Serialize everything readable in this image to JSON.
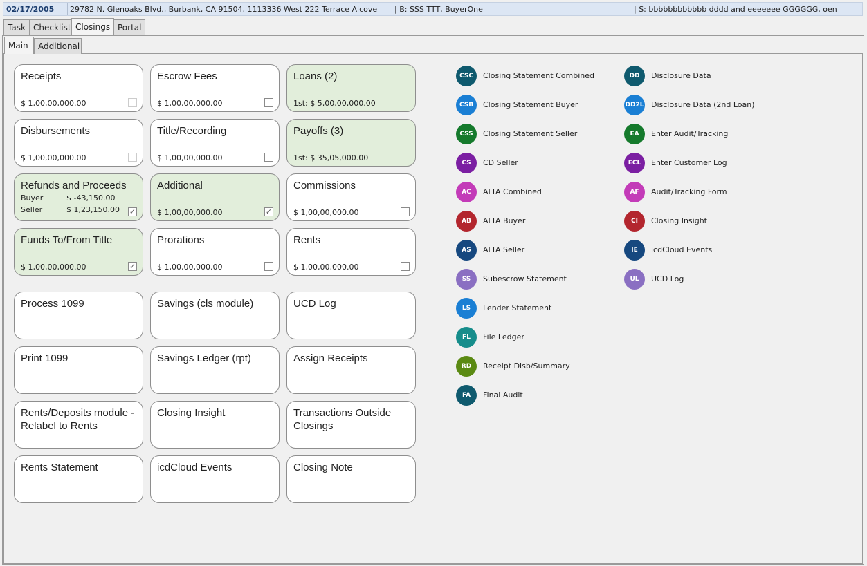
{
  "header": {
    "date": "02/17/2005",
    "address": "29782 N. Glenoaks Blvd., Burbank, CA 91504, 1113336 West 222 Terrace Alcove",
    "buyer": "| B: SSS TTT, BuyerOne",
    "seller": "| S: bbbbbbbbbbbb dddd and eeeeeee GGGGGG, oen"
  },
  "tabs": [
    "Task",
    "Checklist",
    "Closings",
    "Portal"
  ],
  "subtabs": [
    "Main",
    "Additional"
  ],
  "cards": [
    {
      "title": "Receipts",
      "value": "$ 1,00,00,000.00",
      "checkbox": "dim",
      "checked": false
    },
    {
      "title": "Escrow Fees",
      "value": "$ 1,00,00,000.00",
      "checkbox": "normal",
      "checked": false
    },
    {
      "title": "Loans (2)",
      "value": "1st:  $ 5,00,00,000.00",
      "green": true
    },
    {
      "title": "Disbursements",
      "value": "$ 1,00,00,000.00",
      "checkbox": "dim",
      "checked": false
    },
    {
      "title": "Title/Recording",
      "value": "$ 1,00,00,000.00",
      "checkbox": "normal",
      "checked": false
    },
    {
      "title": "Payoffs (3)",
      "value": "1st:  $ 35,05,000.00",
      "green": true
    },
    {
      "title": "Refunds and Proceeds",
      "green": true,
      "buyer_label": "Buyer",
      "buyer_value": "$ -43,150.00",
      "seller_label": "Seller",
      "seller_value": "$ 1,23,150.00",
      "checkbox": "normal",
      "checked": true
    },
    {
      "title": "Additional",
      "value": "$ 1,00,00,000.00",
      "green": true,
      "checkbox": "normal",
      "checked": true
    },
    {
      "title": "Commissions",
      "value": "$ 1,00,00,000.00",
      "checkbox": "normal",
      "checked": false
    },
    {
      "title": "Funds To/From Title",
      "value": "$ 1,00,00,000.00",
      "green": true,
      "checkbox": "normal",
      "checked": true
    },
    {
      "title": "Prorations",
      "value": "$ 1,00,00,000.00",
      "checkbox": "normal",
      "checked": false
    },
    {
      "title": "Rents",
      "value": "$ 1,00,00,000.00",
      "checkbox": "normal",
      "checked": false
    },
    {
      "title": "Process 1099"
    },
    {
      "title": "Savings (cls module)"
    },
    {
      "title": "UCD Log"
    },
    {
      "title": "Print 1099"
    },
    {
      "title": "Savings Ledger (rpt)"
    },
    {
      "title": "Assign Receipts"
    },
    {
      "title": "Rents/Deposits module - Relabel to Rents"
    },
    {
      "title": "Closing Insight"
    },
    {
      "title": "Transactions Outside Closings"
    },
    {
      "title": "Rents Statement"
    },
    {
      "title": "icdCloud Events"
    },
    {
      "title": "Closing Note"
    }
  ],
  "links_col1": [
    {
      "code": "CSC",
      "label": "Closing Statement Combined",
      "color": "#0f5a6e"
    },
    {
      "code": "CSB",
      "label": "Closing Statement Buyer",
      "color": "#1a7fd4"
    },
    {
      "code": "CSS",
      "label": "Closing Statement Seller",
      "color": "#157a2c"
    },
    {
      "code": "CS",
      "label": "CD Seller",
      "color": "#7b1fa2"
    },
    {
      "code": "AC",
      "label": "ALTA Combined",
      "color": "#c33bb8"
    },
    {
      "code": "AB",
      "label": "ALTA Buyer",
      "color": "#b3262e"
    },
    {
      "code": "AS",
      "label": "ALTA Seller",
      "color": "#16487f"
    },
    {
      "code": "SS",
      "label": "Subescrow Statement",
      "color": "#8a6fc2"
    },
    {
      "code": "LS",
      "label": "Lender Statement",
      "color": "#1a7fd4"
    },
    {
      "code": "FL",
      "label": "File Ledger",
      "color": "#168d8b"
    },
    {
      "code": "RD",
      "label": "Receipt Disb/Summary",
      "color": "#5b8a13"
    },
    {
      "code": "FA",
      "label": "Final Audit",
      "color": "#0f5a6e"
    }
  ],
  "links_col2": [
    {
      "code": "DD",
      "label": "Disclosure Data",
      "color": "#0f5a6e"
    },
    {
      "code": "DD2L",
      "label": "Disclosure Data (2nd Loan)",
      "color": "#1a7fd4"
    },
    {
      "code": "EA",
      "label": "Enter Audit/Tracking",
      "color": "#157a2c"
    },
    {
      "code": "ECL",
      "label": "Enter Customer Log",
      "color": "#7b1fa2"
    },
    {
      "code": "AF",
      "label": "Audit/Tracking Form",
      "color": "#c33bb8"
    },
    {
      "code": "CI",
      "label": "Closing Insight",
      "color": "#b3262e"
    },
    {
      "code": "IE",
      "label": "icdCloud Events",
      "color": "#16487f"
    },
    {
      "code": "UL",
      "label": "UCD Log",
      "color": "#8a6fc2"
    }
  ]
}
